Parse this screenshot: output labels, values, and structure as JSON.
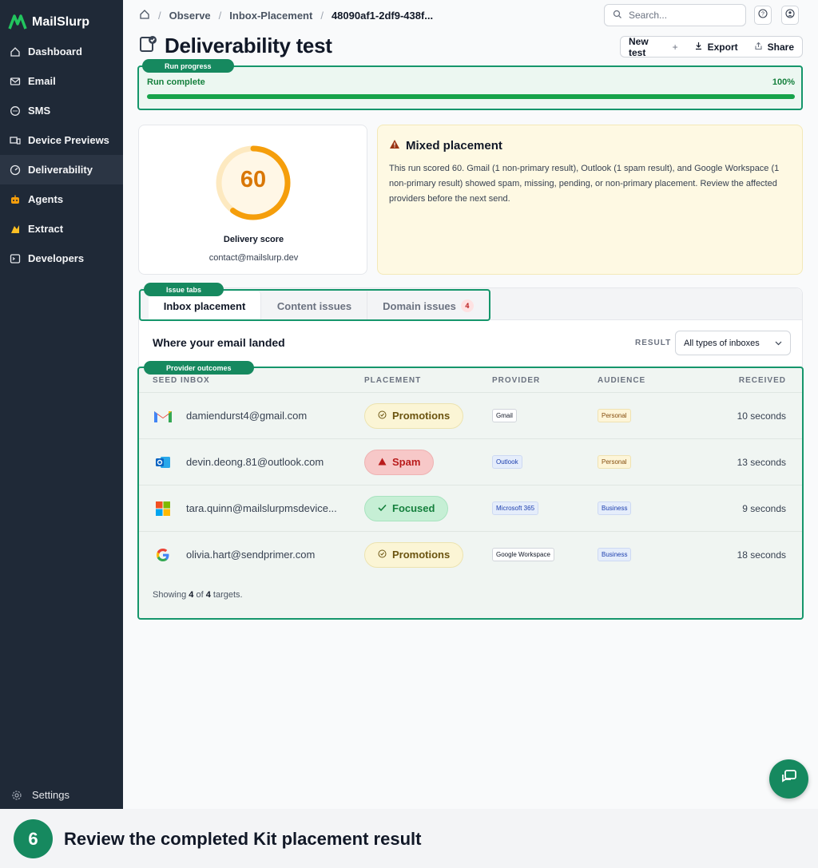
{
  "app": {
    "name": "MailSlurp"
  },
  "sidebar": {
    "items": [
      {
        "label": "Dashboard",
        "icon": "home-icon"
      },
      {
        "label": "Email",
        "icon": "mail-icon"
      },
      {
        "label": "SMS",
        "icon": "chat-bubble-icon"
      },
      {
        "label": "Device Previews",
        "icon": "devices-icon"
      },
      {
        "label": "Deliverability",
        "icon": "gauge-icon",
        "active": true
      },
      {
        "label": "Agents",
        "icon": "robot-icon"
      },
      {
        "label": "Extract",
        "icon": "extract-icon"
      },
      {
        "label": "Developers",
        "icon": "terminal-icon"
      }
    ],
    "settings_label": "Settings"
  },
  "breadcrumb": {
    "items": [
      "Observe",
      "Inbox-Placement",
      "48090af1-2df9-438f..."
    ]
  },
  "search": {
    "placeholder": "Search..."
  },
  "page": {
    "title": "Deliverability test",
    "actions": {
      "new_test": "New test",
      "export": "Export",
      "share": "Share"
    }
  },
  "progress": {
    "tag": "Run progress",
    "label": "Run complete",
    "percent_text": "100%",
    "fraction": 1.0
  },
  "score": {
    "value": "60",
    "fraction": 0.6,
    "label": "Delivery score",
    "email": "contact@mailslurp.dev"
  },
  "alert": {
    "title": "Mixed placement",
    "body": "This run scored 60. Gmail (1 non-primary result), Outlook (1 spam result), and Google Workspace (1 non-primary result) showed spam, missing, pending, or non-primary placement. Review the affected providers before the next send."
  },
  "tabs": {
    "tag": "Issue tabs",
    "items": [
      {
        "label": "Inbox placement",
        "active": true
      },
      {
        "label": "Content issues"
      },
      {
        "label": "Domain issues",
        "count": "4"
      }
    ]
  },
  "results": {
    "title": "Where your email landed",
    "filter_label": "RESULT",
    "filter_value": "All types of inboxes",
    "tag": "Provider outcomes",
    "columns": [
      "SEED INBOX",
      "PLACEMENT",
      "PROVIDER",
      "AUDIENCE",
      "RECEIVED"
    ],
    "rows": [
      {
        "email": "damiendurst4@gmail.com",
        "logo": "gmail-logo-icon",
        "placement": "Promotions",
        "placement_kind": "promo",
        "provider": "Gmail",
        "audience": "Personal",
        "received": "10 seconds"
      },
      {
        "email": "devin.deong.81@outlook.com",
        "logo": "outlook-logo-icon",
        "placement": "Spam",
        "placement_kind": "spam",
        "provider": "Outlook",
        "audience": "Personal",
        "received": "13 seconds"
      },
      {
        "email": "tara.quinn@mailslurpmsdevice...",
        "logo": "microsoft-logo-icon",
        "placement": "Focused",
        "placement_kind": "focus",
        "provider": "Microsoft 365",
        "audience": "Business",
        "received": "9 seconds"
      },
      {
        "email": "olivia.hart@sendprimer.com",
        "logo": "google-logo-icon",
        "placement": "Promotions",
        "placement_kind": "promo",
        "provider": "Google Workspace",
        "audience": "Business",
        "received": "18 seconds"
      }
    ],
    "footer": {
      "prefix": "Showing",
      "shown": "4",
      "of": "of",
      "total": "4",
      "suffix": "targets."
    }
  },
  "caption": {
    "step": "6",
    "text": "Review the completed Kit placement result"
  },
  "colors": {
    "accent": "#16895f",
    "sidebar": "#1f2937",
    "score": "#f59e0b"
  }
}
